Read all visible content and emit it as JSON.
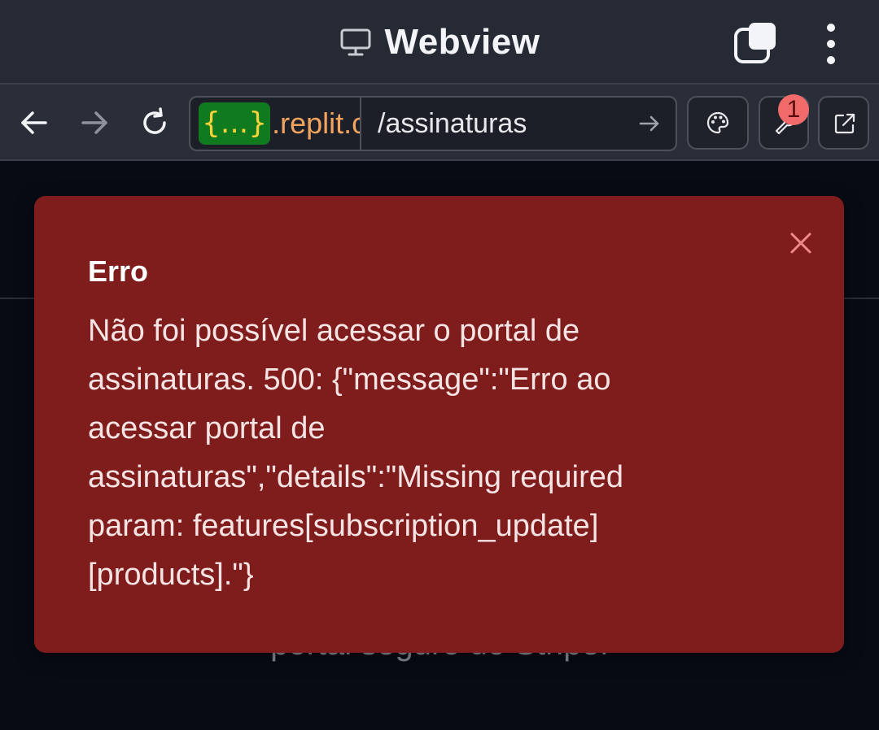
{
  "titlebar": {
    "title": "Webview",
    "icons": {
      "monitor": "monitor-icon",
      "tabs": "tabs-icon",
      "menu": "kebab-menu-icon"
    }
  },
  "navbar": {
    "url": {
      "domain_badge": "{...}",
      "domain_text": ".replit.c",
      "path": "/assinaturas"
    },
    "notification_count": "1",
    "icons": {
      "back": "arrow-left-icon",
      "forward": "arrow-right-icon",
      "reload": "reload-icon",
      "go": "arrow-right-icon",
      "palette": "palette-icon",
      "devtools": "wrench-icon",
      "external": "external-link-icon"
    }
  },
  "page": {
    "background_text": "portal seguro do Stripe."
  },
  "toast": {
    "title": "Erro",
    "message": "Não foi possível acessar o portal de assinaturas. 500: {\"message\":\"Erro ao acessar portal de assinaturas\",\"details\":\"Missing required param: features[subscription_update][products].\"}",
    "color": "#7f1d1d"
  }
}
